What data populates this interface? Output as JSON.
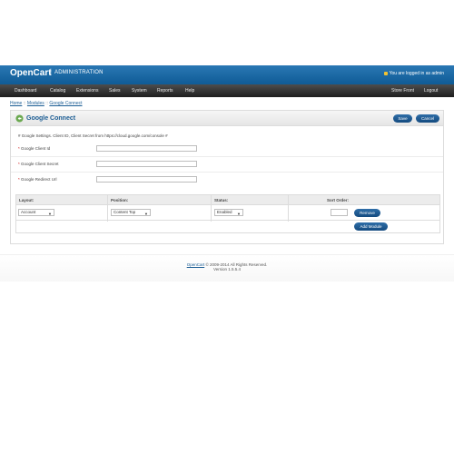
{
  "header": {
    "brand": "OpenCart",
    "separator": "|",
    "admin_label": "ADMINISTRATION",
    "logged_in_text": "You are logged in as admin"
  },
  "menu": {
    "left": [
      "Dashboard",
      "Catalog",
      "Extensions",
      "Sales",
      "System",
      "Reports",
      "Help"
    ],
    "right": [
      "Store Front",
      "Logout"
    ]
  },
  "breadcrumb": {
    "home": "Home",
    "sep": " :: ",
    "modules": "Modules",
    "current": "Google Connect"
  },
  "panel": {
    "title": "Google Connect",
    "save": "Save",
    "cancel": "Cancel",
    "note": "# Google Settings.  Client ID, Client Secret from https://cloud.google.com/console #"
  },
  "fields": [
    {
      "label": "Google Client Id",
      "value": ""
    },
    {
      "label": "Google Client Secret",
      "value": ""
    },
    {
      "label": "Google Redirect Url",
      "value": ""
    }
  ],
  "required_mark": "*",
  "table": {
    "headers": [
      "Layout:",
      "Position:",
      "Status:",
      "Sort Order:"
    ],
    "row": {
      "layout": "Account",
      "position": "Content Top",
      "status": "Enabled",
      "sort_order": "",
      "remove": "Remove"
    },
    "add_module": "Add Module"
  },
  "footer": {
    "link": "OpenCart",
    "copyright": " © 2009-2014 All Rights Reserved.",
    "version": "Version 1.5.5.4"
  },
  "colors": {
    "header_blue": "#1a6aa8",
    "menu_dark": "#2a2a2a",
    "button_blue": "#1d5a92",
    "title_blue": "#1a5c93"
  }
}
